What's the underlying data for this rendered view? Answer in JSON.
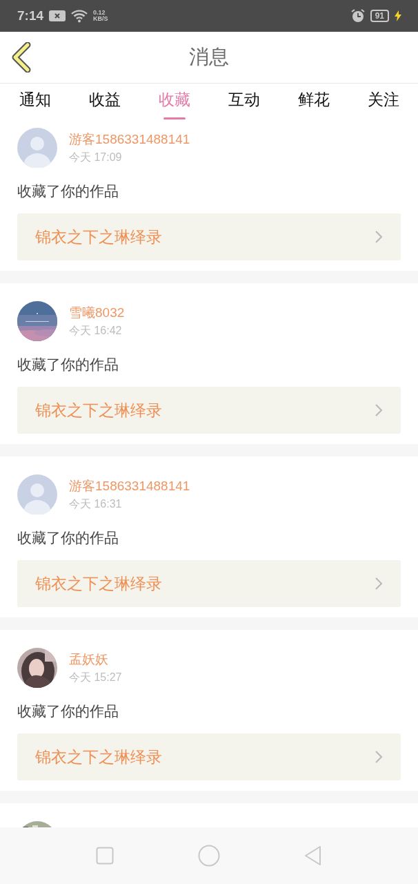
{
  "status_bar": {
    "time": "7:14",
    "net_speed": "0.12",
    "net_unit": "KB/S",
    "battery": "91"
  },
  "header": {
    "title": "消息"
  },
  "tabs": [
    {
      "label": "通知",
      "selected": false
    },
    {
      "label": "收益",
      "selected": false
    },
    {
      "label": "收藏",
      "selected": true
    },
    {
      "label": "互动",
      "selected": false
    },
    {
      "label": "鲜花",
      "selected": false
    },
    {
      "label": "关注",
      "selected": false
    }
  ],
  "messages": [
    {
      "avatar": {
        "kind": "default"
      },
      "user": "游客1586331488141",
      "time": "今天 17:09",
      "action": "收藏了你的作品",
      "work": "锦衣之下之琳绎录"
    },
    {
      "avatar": {
        "kind": "picture"
      },
      "user": "雪曦8032",
      "time": "今天 16:42",
      "action": "收藏了你的作品",
      "work": "锦衣之下之琳绎录"
    },
    {
      "avatar": {
        "kind": "default"
      },
      "user": "游客1586331488141",
      "time": "今天 16:31",
      "action": "收藏了你的作品",
      "work": "锦衣之下之琳绎录"
    },
    {
      "avatar": {
        "kind": "picture"
      },
      "user": "孟妖妖",
      "time": "今天 15:27",
      "action": "收藏了你的作品",
      "work": "锦衣之下之琳绎录"
    },
    {
      "avatar": {
        "kind": "picture"
      }
    }
  ]
}
